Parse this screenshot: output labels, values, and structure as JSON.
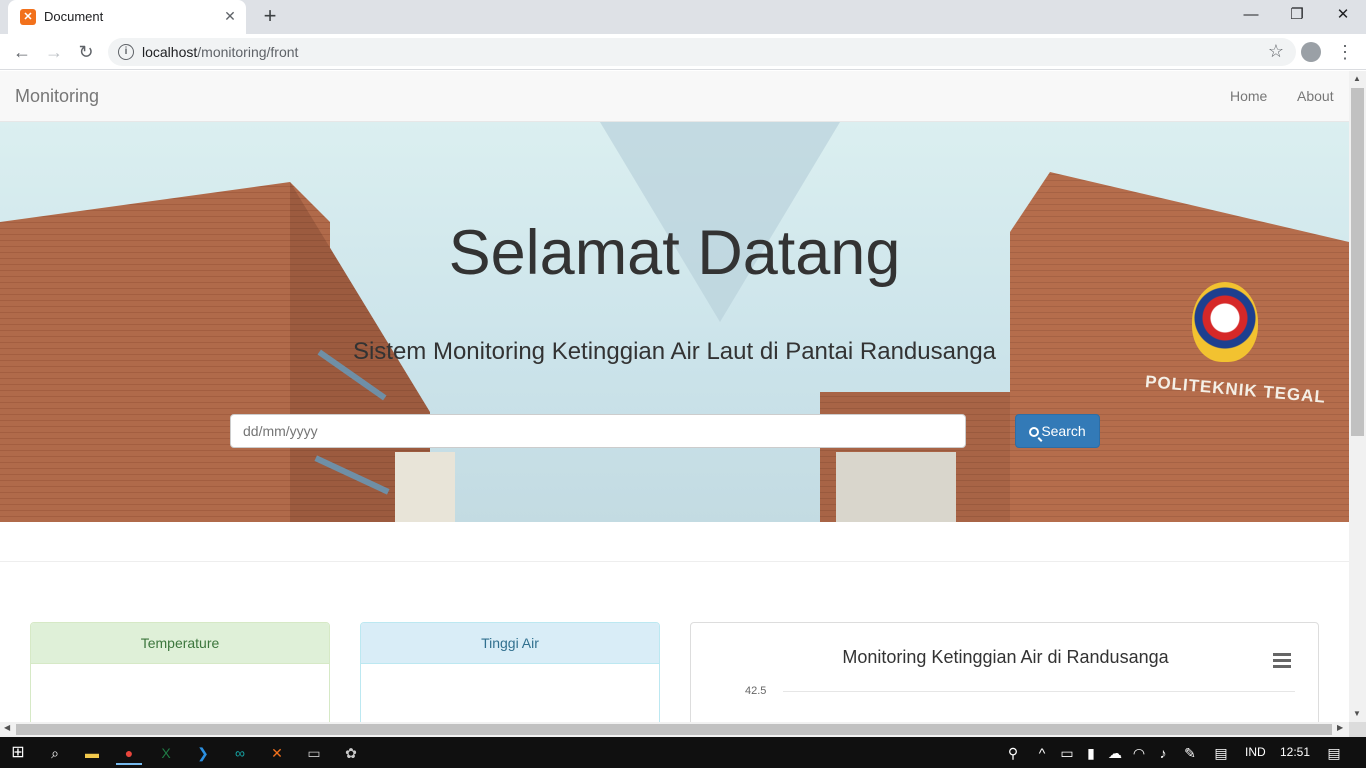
{
  "browser": {
    "tab_title": "Document",
    "tab_favicon": "xampp-icon",
    "url_host": "localhost",
    "url_path": "/monitoring/front"
  },
  "navbar": {
    "brand": "Monitoring",
    "links": [
      {
        "label": "Home"
      },
      {
        "label": "About"
      }
    ]
  },
  "hero": {
    "title": "Selamat Datang",
    "subtitle": "Sistem Monitoring Ketinggian Air Laut di Pantai Randusanga",
    "date_placeholder": "dd/mm/yyyy",
    "search_label": "Search",
    "building_sign": "POLITEKNIK TEGAL"
  },
  "panels": {
    "temperature": {
      "heading": "Temperature"
    },
    "tinggi_air": {
      "heading": "Tinggi Air"
    }
  },
  "chart": {
    "title": "Monitoring Ketinggian Air di Randusanga",
    "ytick_top": "42.5"
  },
  "taskbar": {
    "language": "IND",
    "time": "12:51"
  },
  "colors": {
    "primary_button": "#337ab7",
    "panel_success": "#dff0d8",
    "panel_info": "#d9edf7",
    "taskbar": "#101010"
  }
}
